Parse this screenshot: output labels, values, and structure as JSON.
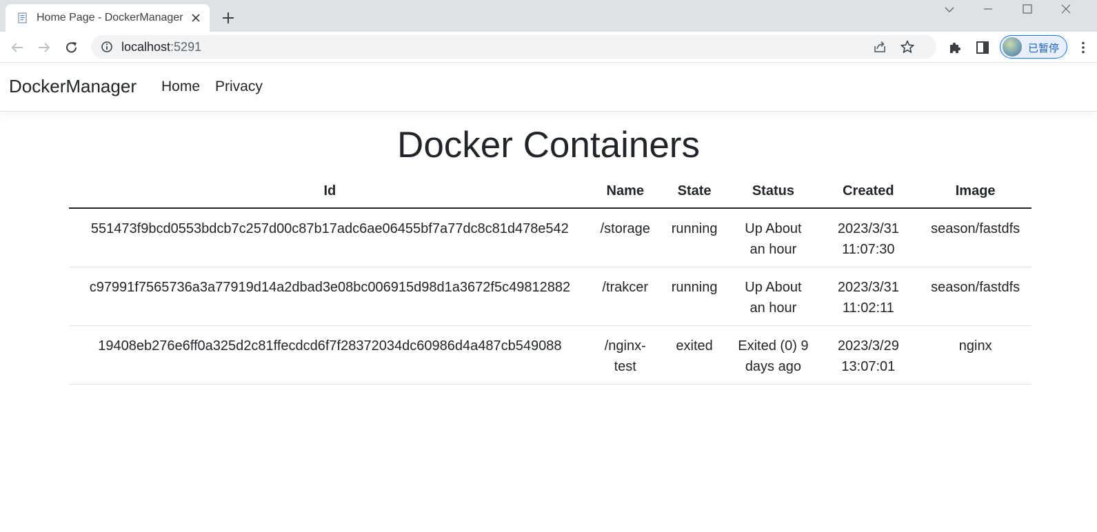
{
  "browser": {
    "tab_title": "Home Page - DockerManager",
    "url_host": "localhost",
    "url_port": ":5291",
    "profile_label": "已暂停",
    "icons": {
      "favicon": "document-icon",
      "tab_close": "close-icon",
      "new_tab": "plus-icon",
      "back": "back-arrow-icon",
      "forward": "forward-arrow-icon",
      "reload": "reload-icon",
      "site_info": "info-icon",
      "share": "share-icon",
      "bookmark": "star-icon",
      "extensions": "puzzle-icon",
      "side_panel": "side-panel-icon",
      "menu": "kebab-menu-icon"
    }
  },
  "navbar": {
    "brand": "DockerManager",
    "links": [
      {
        "label": "Home"
      },
      {
        "label": "Privacy"
      }
    ]
  },
  "main": {
    "title": "Docker Containers",
    "table": {
      "headers": [
        "Id",
        "Name",
        "State",
        "Status",
        "Created",
        "Image"
      ],
      "rows": [
        {
          "id": "551473f9bcd0553bdcb7c257d00c87b17adc6ae06455bf7a77dc8c81d478e542",
          "name": "/storage",
          "state": "running",
          "status": "Up About an hour",
          "created": "2023/3/31 11:07:30",
          "image": "season/fastdfs"
        },
        {
          "id": "c97991f7565736a3a77919d14a2dbad3e08bc006915d98d1a3672f5c49812882",
          "name": "/trakcer",
          "state": "running",
          "status": "Up About an hour",
          "created": "2023/3/31 11:02:11",
          "image": "season/fastdfs"
        },
        {
          "id": "19408eb276e6ff0a325d2c81ffecdcd6f7f28372034dc60986d4a487cb549088",
          "name": "/nginx-test",
          "state": "exited",
          "status": "Exited (0) 9 days ago",
          "created": "2023/3/29 13:07:01",
          "image": "nginx"
        }
      ]
    }
  },
  "colors": {
    "tabstrip": "#dee1e6",
    "text": "#212529",
    "profile_accent": "#1a73e8"
  }
}
